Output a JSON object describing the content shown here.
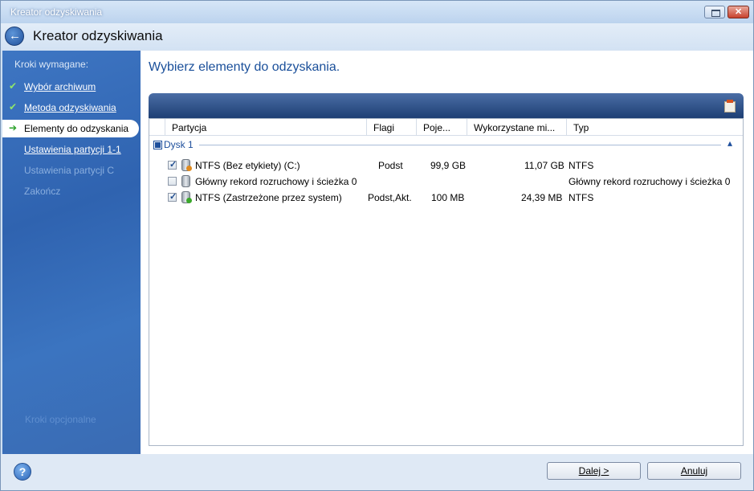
{
  "window": {
    "title": "Kreator odzyskiwania"
  },
  "header": {
    "heading": "Kreator odzyskiwania"
  },
  "sidebar": {
    "section_label": "Kroki wymagane:",
    "steps": [
      {
        "label": "Wybór archiwum",
        "state": "done"
      },
      {
        "label": "Metoda odzyskiwania",
        "state": "done"
      },
      {
        "label": "Elementy do odzyskania",
        "state": "current"
      },
      {
        "label": "Ustawienia partycji 1-1",
        "state": "link"
      },
      {
        "label": "Ustawienia partycji C",
        "state": "disabled"
      },
      {
        "label": "Zakończ",
        "state": "disabled"
      }
    ],
    "optional_label": "Kroki opcjonalne"
  },
  "main": {
    "title": "Wybierz elementy do odzyskania.",
    "columns": [
      "Partycja",
      "Flagi",
      "Poje...",
      "Wykorzystane mi...",
      "Typ"
    ],
    "group": {
      "label": "Dysk 1",
      "caret": "▴"
    },
    "rows": [
      {
        "checked": true,
        "partition": "NTFS (Bez etykiety) (C:)",
        "flags": "Podst",
        "capacity": "99,9 GB",
        "used": "11,07 GB",
        "type": "NTFS",
        "badge_color": "#e08a1e"
      },
      {
        "checked": false,
        "partition": "Główny rekord rozruchowy i ścieżka 0",
        "flags": "",
        "capacity": "",
        "used": "",
        "type": "Główny rekord rozruchowy i ścieżka 0",
        "badge_color": ""
      },
      {
        "checked": true,
        "partition": "NTFS (Zastrzeżone przez system)",
        "flags": "Podst,Akt.",
        "capacity": "100 MB",
        "used": "24,39 MB",
        "type": "NTFS",
        "badge_color": "#3aa82a"
      }
    ]
  },
  "footer": {
    "help_glyph": "?",
    "next_label": "Dalej >",
    "cancel_label": "Anuluj"
  },
  "icons": {
    "back": "arrow-left-icon",
    "help": "help-icon",
    "toolbar": "column-chooser-icon"
  }
}
